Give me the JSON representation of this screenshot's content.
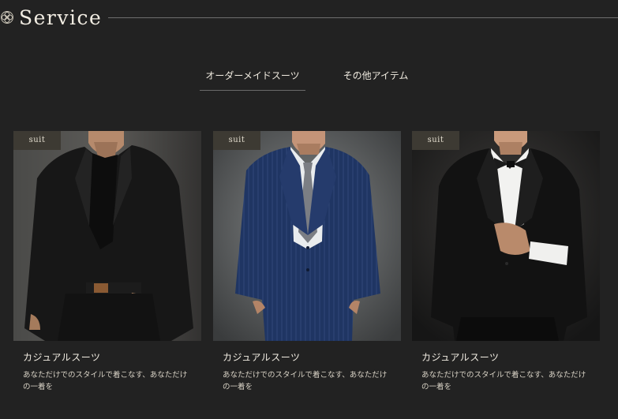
{
  "header": {
    "title": "Service",
    "logo_icon": "floral-emblem-icon"
  },
  "tabs": [
    {
      "label": "オーダーメイドスーツ",
      "active": true
    },
    {
      "label": "その他アイテム",
      "active": false
    }
  ],
  "cards": [
    {
      "tag": "suit",
      "title": "カジュアルスーツ",
      "description": "あなただけでのスタイルで着こなす、あなただけの一着を",
      "photo": "man-in-black-casual-suit"
    },
    {
      "tag": "suit",
      "title": "カジュアルスーツ",
      "description": "あなただけでのスタイルで着こなす、あなただけの一着を",
      "photo": "man-in-navy-pinstripe-suit"
    },
    {
      "tag": "suit",
      "title": "カジュアルスーツ",
      "description": "あなただけでのスタイルで着こなす、あなただけの一着を",
      "photo": "man-in-black-tuxedo-with-bow-tie"
    }
  ],
  "colors": {
    "background": "#222222",
    "tag_background": "#3d3a33",
    "text": "#f2ede3",
    "rule": "#6e6e6e"
  }
}
